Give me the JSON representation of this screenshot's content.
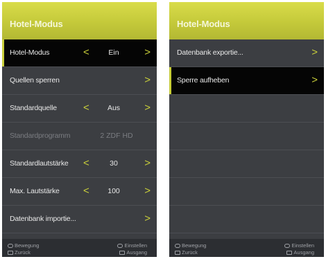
{
  "left": {
    "title": "Hotel-Modus",
    "rows": [
      {
        "label": "Hotel-Modus",
        "value": "Ein",
        "left_arrow": "<",
        "right_arrow": ">"
      },
      {
        "label": "Quellen sperren",
        "right_arrow": ">"
      },
      {
        "label": "Standardquelle",
        "value": "Aus",
        "left_arrow": "<",
        "right_arrow": ">"
      },
      {
        "label": "Standardprogramm",
        "value": "2 ZDF HD"
      },
      {
        "label": "Standardlautstärke",
        "value": "30",
        "left_arrow": "<",
        "right_arrow": ">"
      },
      {
        "label": "Max. Lautstärke",
        "value": "100",
        "left_arrow": "<",
        "right_arrow": ">"
      },
      {
        "label": "Datenbank importie...",
        "right_arrow": ">"
      }
    ],
    "footer": {
      "move": "Bewegung",
      "settings": "Einstellen",
      "back": "Zurück",
      "exit": "Ausgang"
    }
  },
  "right": {
    "title": "Hotel-Modus",
    "rows": [
      {
        "label": "Datenbank exportie...",
        "right_arrow": ">"
      },
      {
        "label": "Sperre aufheben",
        "right_arrow": ">"
      }
    ],
    "footer": {
      "move": "Bewegung",
      "settings": "Einstellen",
      "back": "Zurück",
      "exit": "Ausgang"
    }
  },
  "colors": {
    "accent": "#c9cf3a",
    "background": "#3c3e42",
    "selected": "#050505"
  },
  "icons": {
    "arrow_left": "chevron-left-icon",
    "arrow_right": "chevron-right-icon"
  }
}
